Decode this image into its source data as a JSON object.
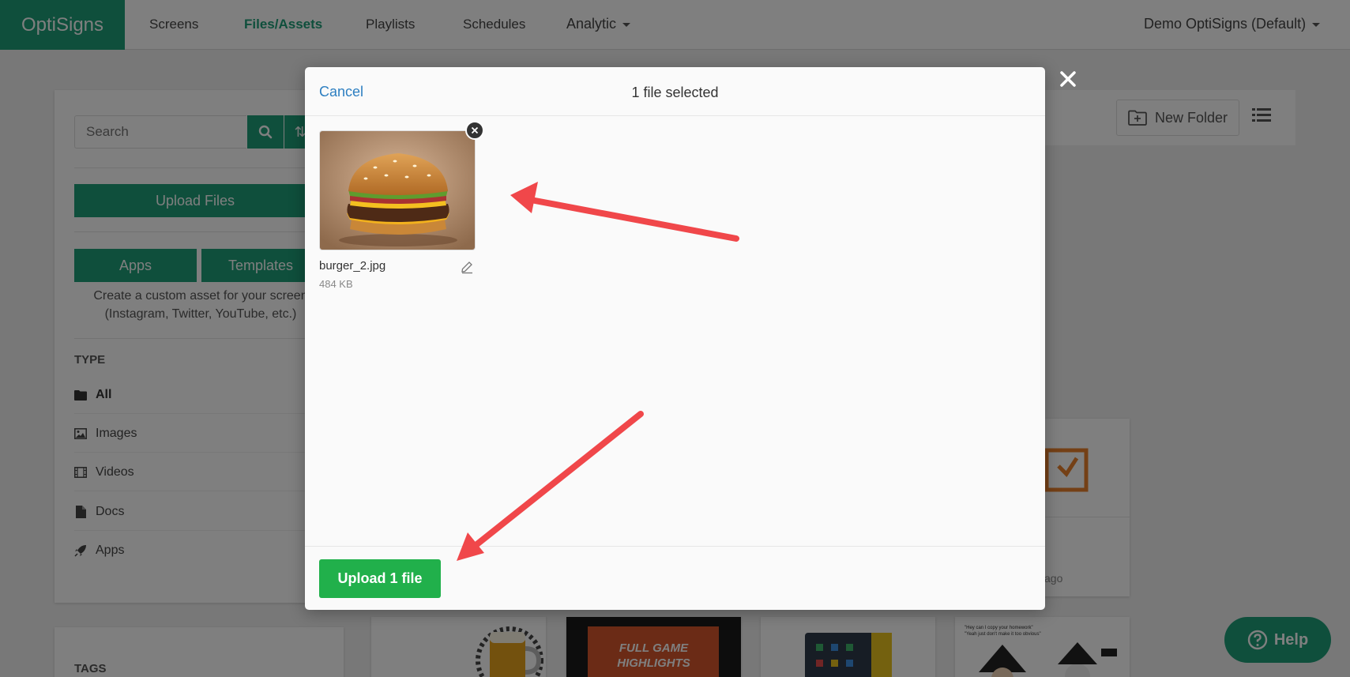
{
  "nav": {
    "brand": "OptiSigns",
    "items": [
      "Screens",
      "Files/Assets",
      "Playlists",
      "Schedules",
      "Analytic"
    ],
    "active": "Files/Assets",
    "account": "Demo OptiSigns (Default)"
  },
  "sidebar": {
    "search_placeholder": "Search",
    "upload_label": "Upload Files",
    "apps_label": "Apps",
    "templates_label": "Templates",
    "custom_asset_text_1": "Create a custom asset for your screen",
    "custom_asset_text_2": "(Instagram, Twitter, YouTube, etc.)",
    "type_heading": "TYPE",
    "types": [
      {
        "label": "All",
        "icon": "folder-icon"
      },
      {
        "label": "Images",
        "icon": "image-icon"
      },
      {
        "label": "Videos",
        "icon": "film-icon"
      },
      {
        "label": "Docs",
        "icon": "file-icon"
      },
      {
        "label": "Apps",
        "icon": "rocket-icon"
      }
    ],
    "tags_heading": "TAGS"
  },
  "toolbar": {
    "new_folder_label": "New Folder"
  },
  "asset_cards": {
    "ago_text": "ago",
    "video_text_1": "FULL GAME",
    "video_text_2": "HIGHLIGHTS",
    "meme_text_1": "\"Hey can I copy your homework\"",
    "meme_text_2": "\"Yeah just don't make it too obvious\""
  },
  "modal": {
    "cancel_label": "Cancel",
    "title": "1 file selected",
    "file_name": "burger_2.jpg",
    "file_size": "484 KB",
    "upload_label": "Upload 1 file"
  },
  "help": {
    "label": "Help"
  },
  "colors": {
    "brand_green": "#1e9e78",
    "upload_green": "#21b04b",
    "link_blue": "#2d7fc1",
    "annotation_red": "#f0474a"
  }
}
